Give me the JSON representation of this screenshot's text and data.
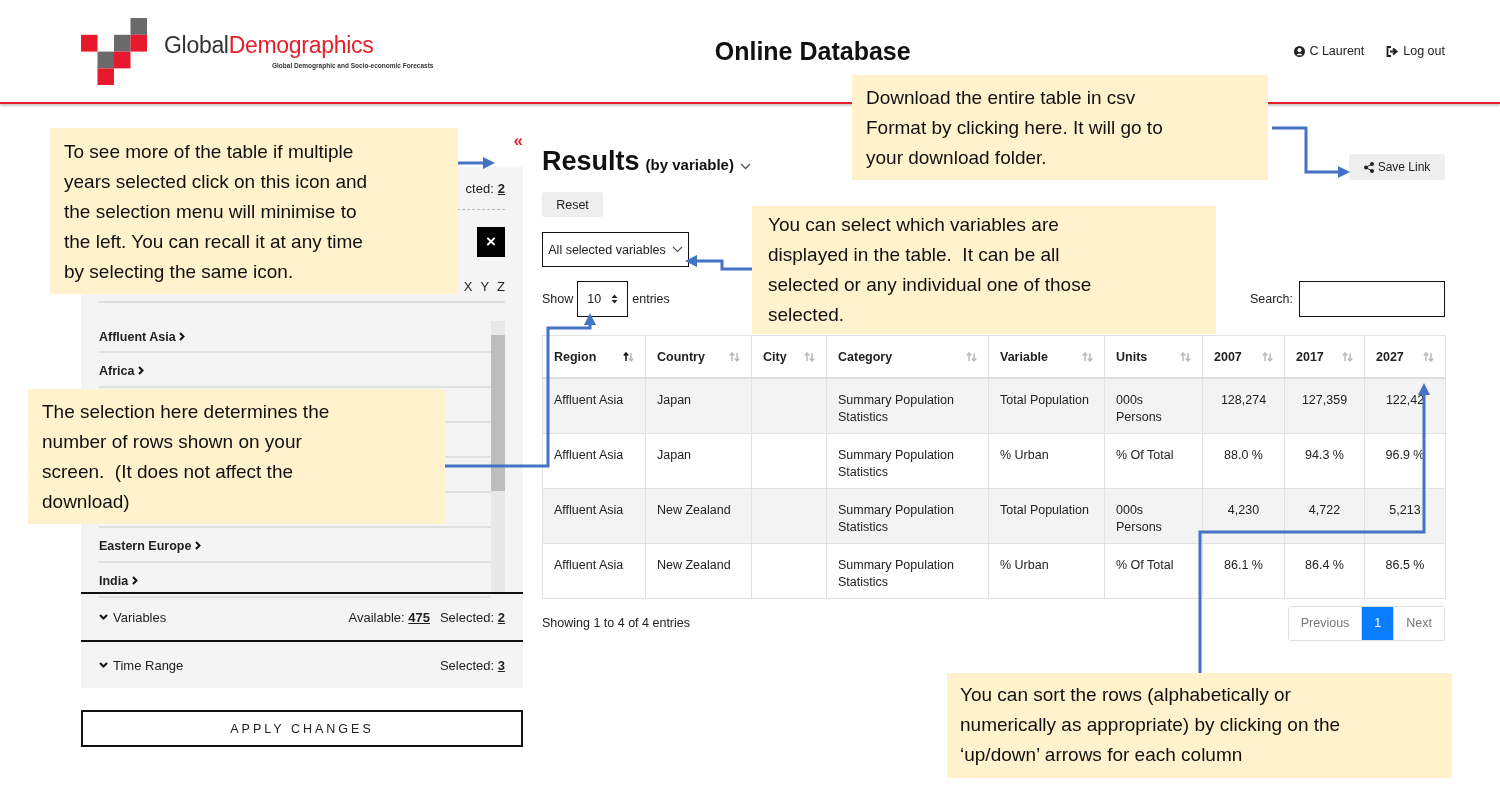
{
  "header": {
    "logo_part1": "Global",
    "logo_part2": "Demographics",
    "tagline": "Global Demographic and Socio-economic Forecasts",
    "title": "Online Database",
    "user": "C Laurent",
    "logout": "Log out"
  },
  "sidebar": {
    "collapse": "«",
    "selected_label": "cted:",
    "selected_count": "2",
    "clear": "×",
    "letters": [
      "X",
      "Y",
      "Z"
    ],
    "regions": [
      {
        "kind": "region",
        "label": "Affluent Asia"
      },
      {
        "kind": "region",
        "label": "Africa"
      },
      {
        "kind": "covered"
      },
      {
        "kind": "covered"
      },
      {
        "kind": "covered"
      },
      {
        "kind": "covered"
      },
      {
        "kind": "region",
        "label": "Eastern Europe"
      },
      {
        "kind": "region",
        "label": "India"
      }
    ],
    "sections": [
      {
        "label": "Variables",
        "available_label": "Available:",
        "available": "475",
        "selected_label": "Selected:",
        "selected": "2"
      },
      {
        "label": "Time Range",
        "selected_label": "Selected:",
        "selected": "3"
      }
    ],
    "apply": "APPLY CHANGES"
  },
  "results": {
    "title": "Results",
    "subtitle": "(by variable)",
    "save": "Save Link",
    "reset": "Reset",
    "variable_select": "All selected variables",
    "show_label": "Show",
    "page_size": "10",
    "entries_label": "entries",
    "search_label": "Search:",
    "columns": [
      {
        "label": "Region",
        "sorted": true
      },
      {
        "label": "Country",
        "sorted": false
      },
      {
        "label": "City",
        "sorted": false
      },
      {
        "label": "Category",
        "sorted": false
      },
      {
        "label": "Variable",
        "sorted": false
      },
      {
        "label": "Units",
        "sorted": false
      },
      {
        "label": "2007",
        "sorted": false
      },
      {
        "label": "2017",
        "sorted": false
      },
      {
        "label": "2027",
        "sorted": false
      }
    ],
    "rows": [
      [
        "Affluent Asia",
        "Japan",
        "",
        "Summary Population Statistics",
        "Total Population",
        "000s Persons",
        "128,274",
        "127,359",
        "122,42"
      ],
      [
        "Affluent Asia",
        "Japan",
        "",
        "Summary Population Statistics",
        "% Urban",
        "% Of Total",
        "88.0 %",
        "94.3 %",
        "96.9 %"
      ],
      [
        "Affluent Asia",
        "New Zealand",
        "",
        "Summary Population Statistics",
        "Total Population",
        "000s Persons",
        "4,230",
        "4,722",
        "5,213"
      ],
      [
        "Affluent Asia",
        "New Zealand",
        "",
        "Summary Population Statistics",
        "% Urban",
        "% Of Total",
        "86.1 %",
        "86.4 %",
        "86.5 %"
      ]
    ],
    "info": "Showing 1 to 4 of 4 entries",
    "pagination": [
      {
        "label": "Previous",
        "selected": false
      },
      {
        "label": "1",
        "selected": true
      },
      {
        "label": "Next",
        "selected": false
      }
    ]
  },
  "callouts": [
    {
      "lines": [
        "To see more of the table if multiple",
        "years selected click on this icon and",
        "the selection menu will minimise to",
        "the left. You can recall it at any time",
        "by selecting the same icon."
      ]
    },
    {
      "lines": [
        "The selection here determines the",
        "number of rows shown on your",
        "screen.  (It does not affect the",
        "download)"
      ]
    },
    {
      "lines": [
        "You can select which variables are",
        "displayed in the table.  It can be all",
        "selected or any individual one of those",
        "selected."
      ]
    },
    {
      "lines": [
        "Download the entire table in csv",
        "Format by clicking here. It will go to",
        "your download folder."
      ]
    },
    {
      "lines": [
        "You can sort the rows (alphabetically or",
        "numerically as appropriate) by clicking on the",
        "‘up/down’ arrows for each column"
      ]
    }
  ]
}
